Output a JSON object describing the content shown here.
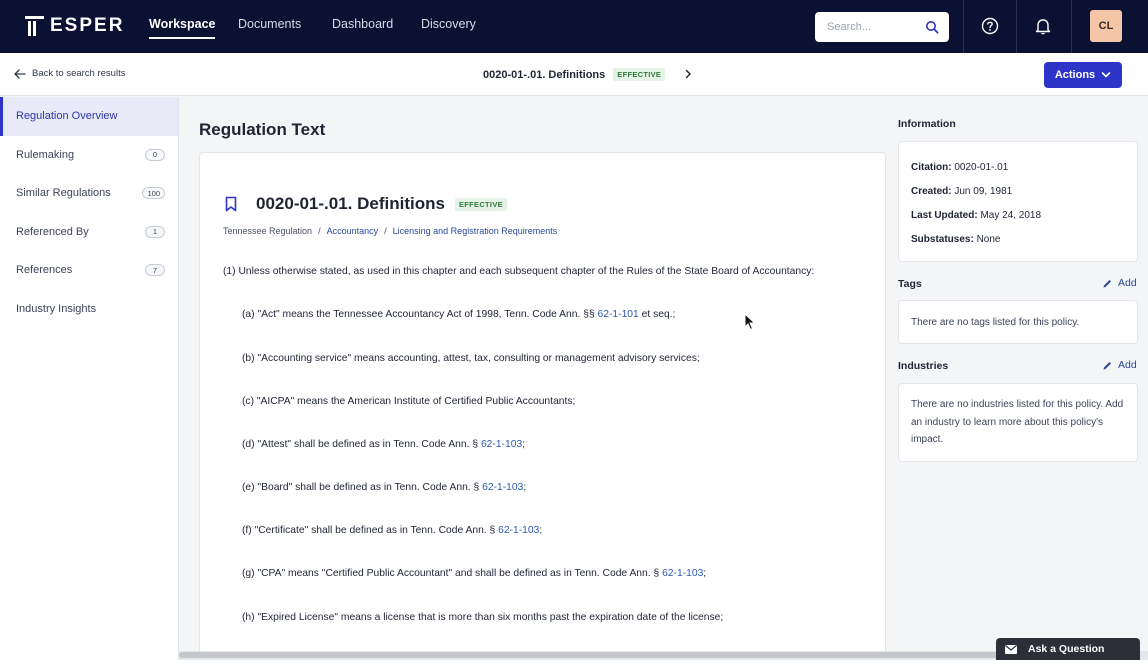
{
  "brand": {
    "name": "ESPER"
  },
  "nav": {
    "items": [
      "Workspace",
      "Documents",
      "Dashboard",
      "Discovery"
    ],
    "active": "Workspace"
  },
  "search": {
    "placeholder": "Search..."
  },
  "user": {
    "initials": "CL"
  },
  "subheader": {
    "back_label": "Back to search results",
    "title": "0020-01-.01. Definitions",
    "status": "EFFECTIVE",
    "actions_label": "Actions"
  },
  "sidebar": {
    "items": [
      {
        "label": "Regulation Overview",
        "active": true
      },
      {
        "label": "Rulemaking",
        "count": "0"
      },
      {
        "label": "Similar Regulations",
        "count": "100"
      },
      {
        "label": "Referenced By",
        "count": "1"
      },
      {
        "label": "References",
        "count": "7"
      },
      {
        "label": "Industry Insights"
      }
    ]
  },
  "main": {
    "section_title": "Regulation Text",
    "doc_title": "0020-01-.01. Definitions",
    "doc_status": "EFFECTIVE",
    "breadcrumb": [
      "Tennessee Regulation",
      "Accountancy",
      "Licensing and Registration Requirements"
    ],
    "intro": "(1) Unless otherwise stated, as used in this chapter and each subsequent chapter of the Rules of the State Board of Accountancy:",
    "paragraphs": [
      {
        "pre": "(a) \"Act\" means the Tennessee Accountancy Act of 1998, Tenn. Code Ann. §§ ",
        "link": "62-1-101",
        "post": " et seq.;"
      },
      {
        "pre": "(b) \"Accounting service\" means accounting, attest, tax, consulting or management advisory services;",
        "link": "",
        "post": ""
      },
      {
        "pre": "(c) \"AICPA\" means the American Institute of Certified Public Accountants;",
        "link": "",
        "post": ""
      },
      {
        "pre": "(d) \"Attest\" shall be defined as in Tenn. Code Ann. § ",
        "link": "62-1-103",
        "post": ";"
      },
      {
        "pre": "(e) \"Board\" shall be defined as in Tenn. Code Ann. § ",
        "link": "62-1-103",
        "post": ";"
      },
      {
        "pre": "(f) \"Certificate\" shall be defined as in Tenn. Code Ann. § ",
        "link": "62-1-103",
        "post": ";"
      },
      {
        "pre": "(g) \"CPA\" means \"Certified Public Accountant\" and shall be defined as in Tenn. Code Ann. § ",
        "link": "62-1-103",
        "post": ";"
      },
      {
        "pre": "(h) \"Expired License\" means a license that is more than six months past the expiration date of the license;",
        "link": "",
        "post": ""
      }
    ]
  },
  "info": {
    "heading": "Information",
    "citation_label": "Citation:",
    "citation": "0020-01-.01",
    "created_label": "Created:",
    "created": "Jun 09, 1981",
    "updated_label": "Last Updated:",
    "updated": "May 24, 2018",
    "substatus_label": "Substatuses:",
    "substatus": "None"
  },
  "tags": {
    "heading": "Tags",
    "add_label": "Add",
    "empty": "There are no tags listed for this policy."
  },
  "industries": {
    "heading": "Industries",
    "add_label": "Add",
    "empty": "There are no industries listed for this policy. Add an industry to learn more about this policy's impact."
  },
  "help": {
    "ask_label": "Ask a Question"
  },
  "colors": {
    "nav_bg": "#0b1133",
    "accent": "#2d34c8",
    "status_green": "#2f7a3a",
    "link": "#2d5bb0"
  },
  "icons": [
    "search-icon",
    "help-icon",
    "bell-icon",
    "arrow-left-icon",
    "chevron-right-icon",
    "chevron-down-icon",
    "bookmark-icon",
    "pencil-icon",
    "mail-icon"
  ]
}
